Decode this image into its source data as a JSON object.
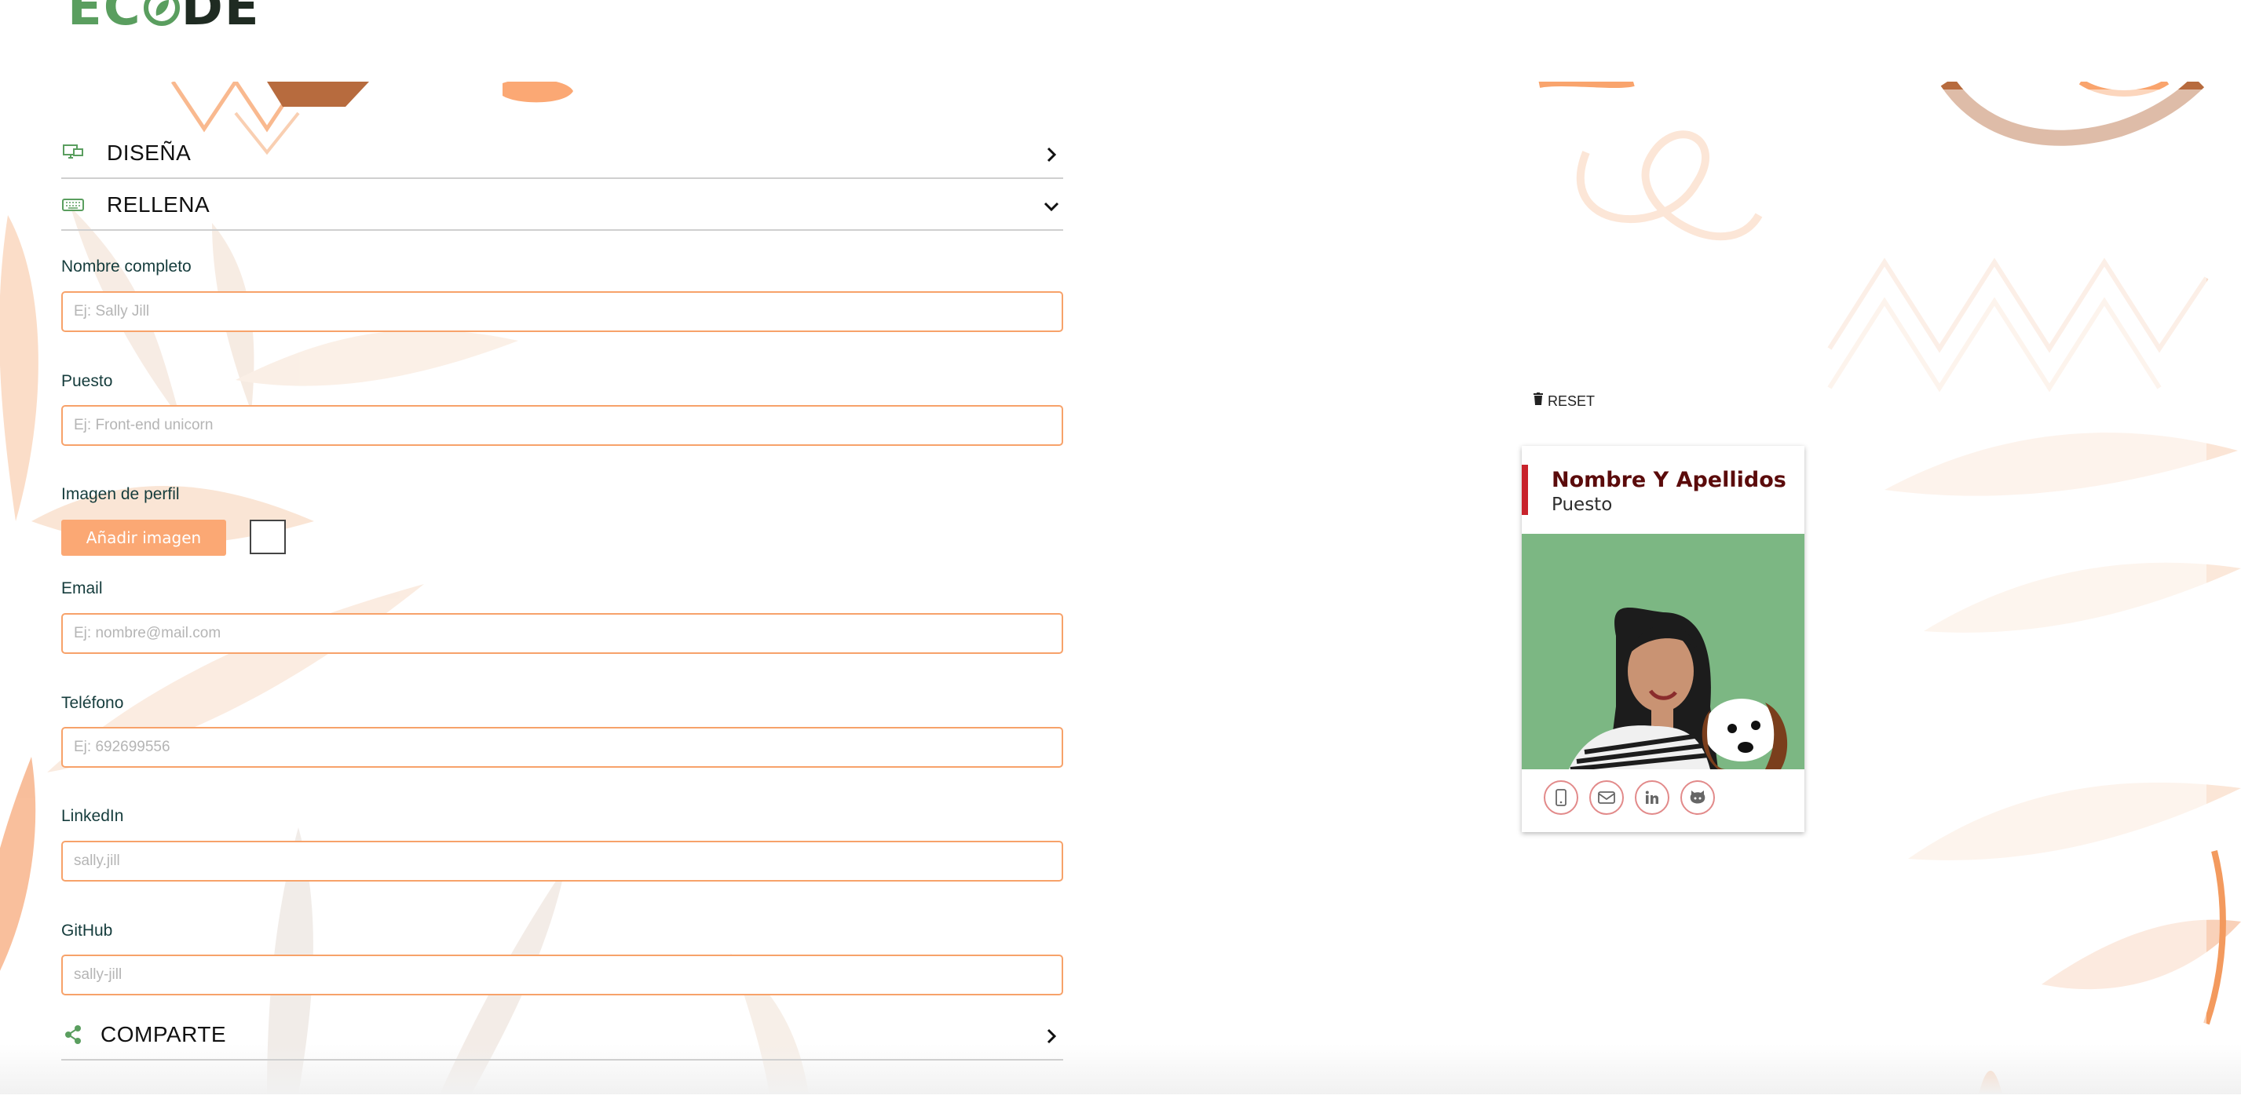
{
  "brand": {
    "logo_text_start": "EC",
    "logo_text_end": "DE"
  },
  "sections": {
    "design": {
      "title": "DISEÑA",
      "icon": "monitor-icon",
      "state": "collapsed"
    },
    "fill": {
      "title": "RELLENA",
      "icon": "keyboard-icon",
      "state": "expanded"
    },
    "share": {
      "title": "COMPARTE",
      "icon": "share-icon",
      "state": "collapsed"
    }
  },
  "form": {
    "name": {
      "label": "Nombre completo",
      "placeholder": "Ej: Sally Jill",
      "value": ""
    },
    "job": {
      "label": "Puesto",
      "placeholder": "Ej: Front-end unicorn",
      "value": ""
    },
    "photo": {
      "label": "Imagen de perfil",
      "button_label": "Añadir imagen"
    },
    "email": {
      "label": "Email",
      "placeholder": "Ej: nombre@mail.com",
      "value": ""
    },
    "phone": {
      "label": "Teléfono",
      "placeholder": "Ej: 692699556",
      "value": ""
    },
    "linkedin": {
      "label": "LinkedIn",
      "placeholder": "sally.jill",
      "value": ""
    },
    "github": {
      "label": "GitHub",
      "placeholder": "sally-jill",
      "value": ""
    }
  },
  "preview": {
    "reset_label": "RESET",
    "card": {
      "name": "Nombre Y Apellidos",
      "job": "Puesto",
      "icons": [
        "mobile-icon",
        "envelope-icon",
        "linkedin-icon",
        "github-icon"
      ]
    }
  },
  "colors": {
    "accent_orange": "#fba874",
    "input_border": "#f7a26a",
    "brand_green": "#5a9e5f",
    "card_bar": "#c8232c",
    "card_name": "#5b0b0b",
    "photo_bg": "#7cb783"
  }
}
